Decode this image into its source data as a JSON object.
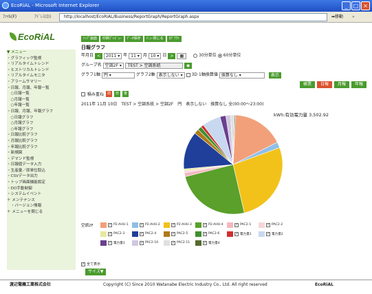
{
  "window": {
    "title": "EcoRiAL - Microsoft Internet Explorer",
    "min": "_",
    "max": "□",
    "close": "×"
  },
  "toolbar": {
    "menus": "ﾌｧｲﾙ(F)",
    "address_label": "ｱﾄﾞﾚｽ(D)",
    "url": "http://localhost/EcoRiAL/Business/ReportGraph/ReportGraph.aspx",
    "go": "移動",
    "links": "»"
  },
  "sidebar": {
    "logo": "EcoRiAL",
    "items": [
      "▼ メニュー",
      "・グラフィック監視",
      "・リアルタイムトレンド",
      "・ヒストリカルトレンド",
      "・リアルタイムモニタ",
      "・アラームサマリー",
      "・日報、月報、年報一覧",
      "　○日報一覧",
      "　○月報一覧",
      "　○年報一覧",
      "・日報、月報、年報グラフ",
      "　○日報グラフ",
      "　○月報グラフ",
      "　○年報グラフ",
      "・日報比較グラフ",
      "・月報比較グラフ",
      "・年報比較グラフ",
      "・新規図",
      "・デマンド監視",
      "・日報値データ入力",
      "・生産量／原単位取込",
      "・CSVデータ出力",
      "・トップ画面機能設定",
      "・DO手動制御",
      "・システムイベント",
      "＋ メンテナンス",
      "　・バージョン情報",
      "＋ メニューを閉じる"
    ]
  },
  "content": {
    "top_buttons": [
      "ﾄｯﾌﾟ画面",
      "印刷ﾌﾟﾚﾋﾞｭｰ",
      "ﾃﾞｰﾀ保存",
      "ﾒﾆｭｰ閉じる",
      "ﾛｸﾞｱｳﾄ"
    ],
    "page_title": "日報グラフ",
    "date": {
      "label": "年月日",
      "year": "2011",
      "month": "11",
      "day": "10",
      "u_year": "年",
      "u_month": "月",
      "u_day": "日",
      "prev": "<",
      "next": ">",
      "cal": "▦",
      "opt1": "30分単位",
      "opt2": "60分単位"
    },
    "group": {
      "label": "グループ名",
      "select": "空調2F",
      "value": "TEST > 空調系統",
      "btn": "◉"
    },
    "axis": {
      "label1": "グラフ1軸",
      "sel1": "円",
      "label2": "グラフ2軸",
      "sel2": "表示しない",
      "cb3d": "3D",
      "conv_label": "1軸換算値",
      "conv": "換算なし",
      "show": "表示"
    },
    "modes": [
      "帳票",
      "日報",
      "月報",
      "年報"
    ],
    "small": {
      "label": "積み重ね",
      "b1": "前",
      "b2": "日",
      "b3": "後"
    },
    "subtitle": "2011年 11月 10日　TEST > 空調系統 > 空調2F　円　表示しない　換算なし 全(00:00～23:00)",
    "total_label": "kWh:有効電力量",
    "total_value": "3,502.92",
    "legend_label": "空調2F",
    "show_all": "全て表示",
    "size_btn": "サイズ▼"
  },
  "chart_data": {
    "type": "pie",
    "title": "kWh:有効電力量 3,502.92",
    "series": [
      {
        "name": "P2-AHU-1",
        "value": 530,
        "color": "#f2a07a"
      },
      {
        "name": "P2-AHU-2",
        "value": 60,
        "color": "#8fbfe8"
      },
      {
        "name": "P2-AHU-3",
        "value": 850,
        "color": "#f2c21a"
      },
      {
        "name": "P2-AHU-4",
        "value": 780,
        "color": "#5aa02a"
      },
      {
        "name": "PAC2-1",
        "value": 40,
        "color": "#f4b8c0"
      },
      {
        "name": "PAC2-2",
        "value": 20,
        "color": "#f7d6d8"
      },
      {
        "name": "PAC2-3",
        "value": 20,
        "color": "#e8e8a0"
      },
      {
        "name": "PAC2-4",
        "value": 390,
        "color": "#1f3f9a"
      },
      {
        "name": "PAC2-5",
        "value": 50,
        "color": "#b07a18"
      },
      {
        "name": "PAC2-6",
        "value": 40,
        "color": "#3f8f2f"
      },
      {
        "name": "電力量1",
        "value": 30,
        "color": "#d02f2f"
      },
      {
        "name": "電力量2",
        "value": 190,
        "color": "#c8d8f0"
      },
      {
        "name": "電力量3",
        "value": 60,
        "color": "#6a3f8f"
      },
      {
        "name": "PAC2-10",
        "value": 50,
        "color": "#d0c8e0"
      },
      {
        "name": "PAC2-11",
        "value": 40,
        "color": "#e0e0e0"
      },
      {
        "name": "電力量4",
        "value": 10,
        "color": "#556b2f"
      }
    ]
  },
  "footer": {
    "company": "渡辺電機工業株式会社",
    "copyright": "Copyright (C) Since 2010 Watanabe Electric Industry Co., Ltd. All right reserved",
    "brand": "EcoRiAL"
  }
}
